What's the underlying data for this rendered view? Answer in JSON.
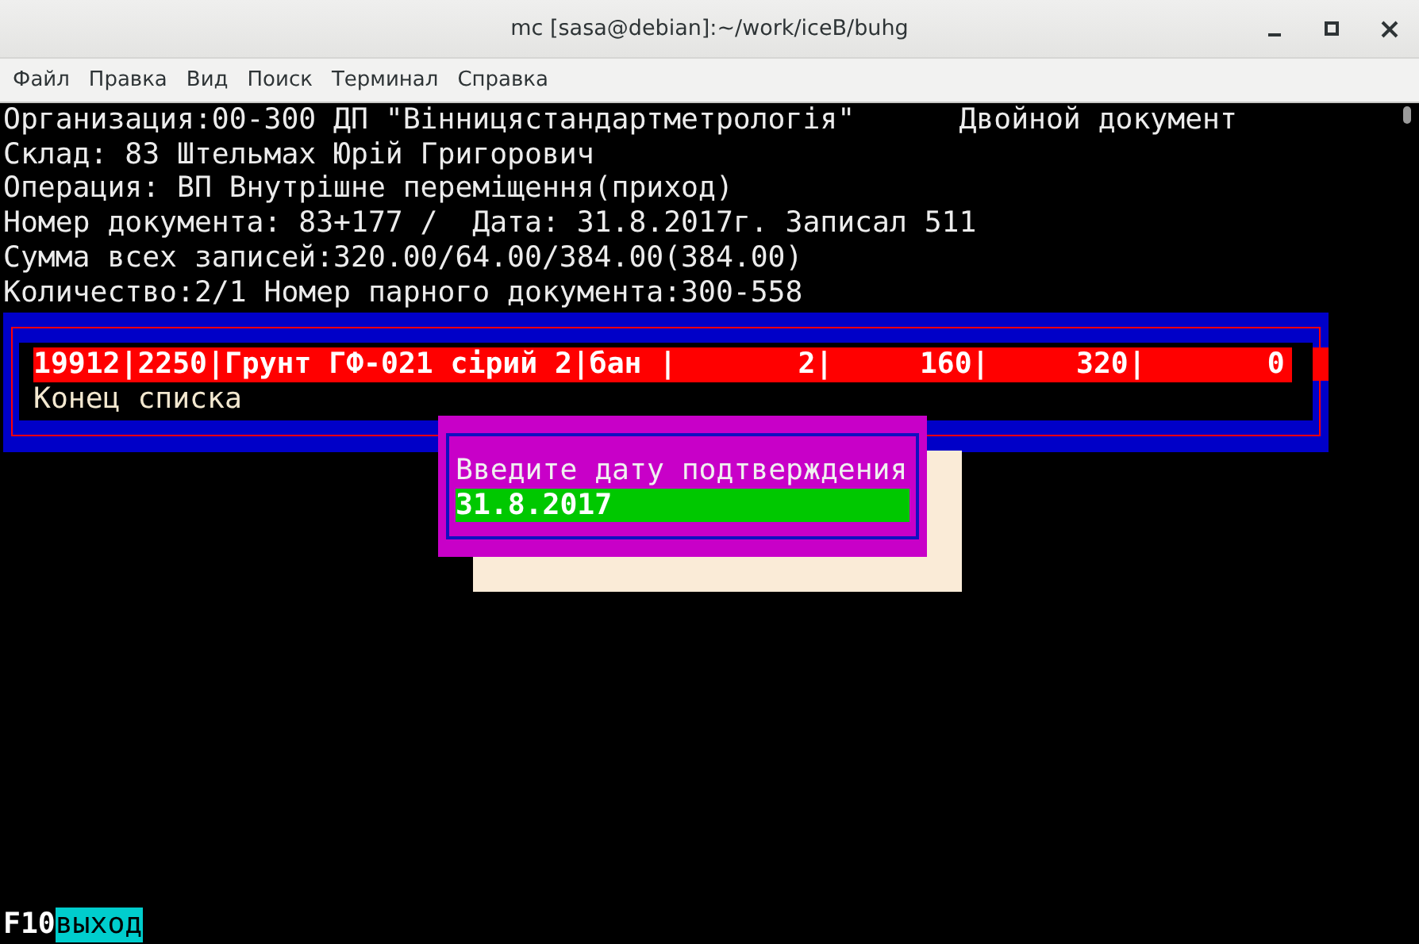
{
  "window": {
    "title": "mc [sasa@debian]:~/work/iceB/buhg"
  },
  "menu": [
    "Файл",
    "Правка",
    "Вид",
    "Поиск",
    "Терминал",
    "Справка"
  ],
  "header": {
    "organization": "Организация:00-300 ДП \"Вінницястандартметрологія\"",
    "doc_type": "Двойной документ",
    "lines": [
      "Склад: 83 Штельмах Юрій Григорович",
      "Операция: ВП Внутрішне переміщення(приход)",
      "Номер документа: 83+177 /  Дата: 31.8.2017г. Записал 511",
      "Сумма всех записей:320.00/64.00/384.00(384.00)",
      "Количество:2/1 Номер парного документа:300-558"
    ]
  },
  "list": {
    "rows": [
      {
        "text": "19912|2250|Грунт ГФ-021 сірий 2|бан |       2|     160|     320|       0",
        "selected": true
      },
      {
        "text": "Конец списка",
        "selected": false
      }
    ]
  },
  "dialog": {
    "prompt": "Введите дату подтверждения",
    "value": "31.8.2017"
  },
  "function_keys": [
    {
      "key": "F10",
      "label": "выход"
    }
  ]
}
